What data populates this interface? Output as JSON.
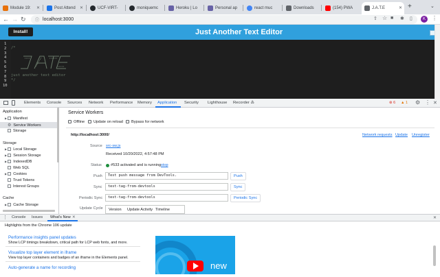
{
  "browser": {
    "tabs": [
      {
        "label": "Module 19:",
        "color": "#e8710a",
        "active": false
      },
      {
        "label": "Post Attend",
        "color": "#1a73e8",
        "active": false
      },
      {
        "label": "UCF-VIRT-",
        "color": "#24292e",
        "active": false
      },
      {
        "label": "moniquemc",
        "color": "#24292e",
        "active": false
      },
      {
        "label": "Heroku | Lo",
        "color": "#6762a6",
        "active": false
      },
      {
        "label": "Personal ap",
        "color": "#6762a6",
        "active": false
      },
      {
        "label": "react muc",
        "color": "#4285f4",
        "active": false
      },
      {
        "label": "Downloads",
        "color": "#5f6368",
        "active": false
      },
      {
        "label": "(154) PWA",
        "color": "#ff0000",
        "active": false
      },
      {
        "label": "J.A.T.E",
        "color": "#5f6368",
        "active": true
      }
    ],
    "new_tab": "+",
    "address": "localhost:3000",
    "profile_initial": "K"
  },
  "app": {
    "install_label": "Install!",
    "title": "Just Another Text Editor",
    "line_numbers": [
      "1",
      "2",
      "3",
      "4",
      "5",
      "6",
      "7",
      "8",
      "9",
      "10"
    ],
    "code_open": "/*",
    "code_tagline": "just another text editor",
    "code_close": "*/"
  },
  "devtools": {
    "tabs": [
      "Elements",
      "Console",
      "Sources",
      "Network",
      "Performance",
      "Memory",
      "Application",
      "Security",
      "Lighthouse",
      "Recorder ♳"
    ],
    "active_tab": "Application",
    "warn_count": "6",
    "issue_count": "1",
    "sidebar": {
      "application_header": "Application",
      "application_items": [
        "Manifest",
        "Service Workers",
        "Storage"
      ],
      "storage_header": "Storage",
      "storage_items": [
        "Local Storage",
        "Session Storage",
        "IndexedDB",
        "Web SQL",
        "Cookies",
        "Trust Tokens",
        "Interest Groups"
      ],
      "cache_header": "Cache",
      "cache_items": [
        "Cache Storage"
      ]
    },
    "service_workers": {
      "heading": "Service Workers",
      "offline": "Offline",
      "update_on_reload": "Update on reload",
      "bypass": "Bypass for network",
      "origin": "http://localhost:3000/",
      "network_requests": "Network requests",
      "update": "Update",
      "unregister": "Unregister",
      "source_label": "Source",
      "source_file": "src-sw.js",
      "received": "Received 10/20/2022, 4:57:48 PM",
      "status_label": "Status",
      "status_text": "#533 activated and is running",
      "stop": "stop",
      "push_label": "Push",
      "push_value": "Test push message from DevTools.",
      "push_btn": "Push",
      "sync_label": "Sync",
      "sync_value": "test-tag-from-devtools",
      "sync_btn": "Sync",
      "periodic_label": "Periodic Sync",
      "periodic_value": "test-tag-from-devtools",
      "periodic_btn": "Periodic Sync",
      "cycle_label": "Update Cycle",
      "cycle_cols": [
        "Version",
        "Update Activity",
        "Timeline"
      ]
    },
    "drawer": {
      "tabs": [
        "Console",
        "Issues",
        "What's New"
      ],
      "active_tab": "What's New",
      "highlights": "Highlights from the Chrome 106 update",
      "cards": [
        {
          "title": "Performance insights panel updates",
          "desc": "Show LCP timings breakdown, critical path for LCP web fonts, and more."
        },
        {
          "title": "Visualize top layer element in iframe",
          "desc": "View top layer containers and badges of an iframe in the Elements panel."
        },
        {
          "title": "Auto-generate a name for recording",
          "desc": ""
        }
      ],
      "video_text": "new"
    }
  }
}
